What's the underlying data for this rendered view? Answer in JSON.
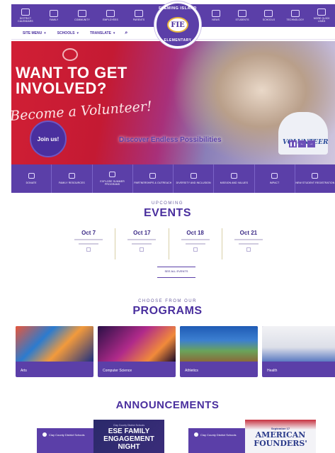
{
  "topnav": {
    "left": [
      {
        "icon": "calendar-icon",
        "label": "District Calendars"
      },
      {
        "icon": "family-icon",
        "label": "Family"
      },
      {
        "icon": "community-icon",
        "label": "Community"
      },
      {
        "icon": "id-card-icon",
        "label": "Employees"
      },
      {
        "icon": "parents-icon",
        "label": "Parents"
      }
    ],
    "right": [
      {
        "icon": "news-icon",
        "label": "News"
      },
      {
        "icon": "graduation-cap-icon",
        "label": "Students"
      },
      {
        "icon": "school-icon",
        "label": "Schools"
      },
      {
        "icon": "laptop-icon",
        "label": "Technology"
      },
      {
        "icon": "link-icon",
        "label": "More Quick Links"
      }
    ]
  },
  "subnav": {
    "site_menu": "Site Menu",
    "schools": "Schools",
    "translate": "Translate"
  },
  "logo": {
    "ring_top": "FLEMING ISLAND",
    "initials": "FIE",
    "ring_bottom": "ELEMENTARY"
  },
  "hero": {
    "headline_line1": "WANT TO GET",
    "headline_line2": "INVOLVED?",
    "script_text": "Become a Volunteer!",
    "join_button": "Join us!",
    "tagline": "Discover Endless Possibilities",
    "shirt_text": "VOLUNTEER",
    "controls": [
      "❚❚",
      "←",
      "→"
    ]
  },
  "quicklinks": [
    {
      "icon": "donate-icon",
      "label": "Donate"
    },
    {
      "icon": "family-resources-icon",
      "label": "Family Resources"
    },
    {
      "icon": "summer-programs-icon",
      "label": "Explore Summer Programs"
    },
    {
      "icon": "partnership-icon",
      "label": "Partnerships & Outreach"
    },
    {
      "icon": "globe-icon",
      "label": "Diversity and Inclusion"
    },
    {
      "icon": "mission-icon",
      "label": "Mission and Values"
    },
    {
      "icon": "impact-icon",
      "label": "Impact"
    },
    {
      "icon": "registration-icon",
      "label": "New Student Registration"
    }
  ],
  "events": {
    "eyebrow": "Upcoming",
    "heading": "EVENTS",
    "items": [
      {
        "date": "Oct 7"
      },
      {
        "date": "Oct 17"
      },
      {
        "date": "Oct 18"
      },
      {
        "date": "Oct 21"
      }
    ],
    "see_all": "See All Events"
  },
  "programs": {
    "eyebrow": "Choose from our",
    "heading": "PROGRAMS",
    "items": [
      {
        "label": "Arts",
        "img": "arts"
      },
      {
        "label": "Computer Science",
        "img": "cs"
      },
      {
        "label": "Athletics",
        "img": "ath"
      },
      {
        "label": "Health",
        "img": "health"
      }
    ]
  },
  "announcements": {
    "heading": "ANNOUNCEMENTS",
    "cards": [
      {
        "source": "Clay County District Schools",
        "graphic_small": "Clay County District Schools",
        "graphic_line1": "ESE FAMILY",
        "graphic_line2": "ENGAGEMENT",
        "graphic_line3": "NIGHT"
      },
      {
        "source": "Clay County District Schools",
        "graphic_small": "September 17",
        "graphic_line1": "AMERICAN",
        "graphic_line2": "FOUNDERS'"
      }
    ]
  },
  "colors": {
    "primary": "#5b3fa8",
    "accent_red": "#d11f35",
    "gold": "#e7b53c"
  }
}
